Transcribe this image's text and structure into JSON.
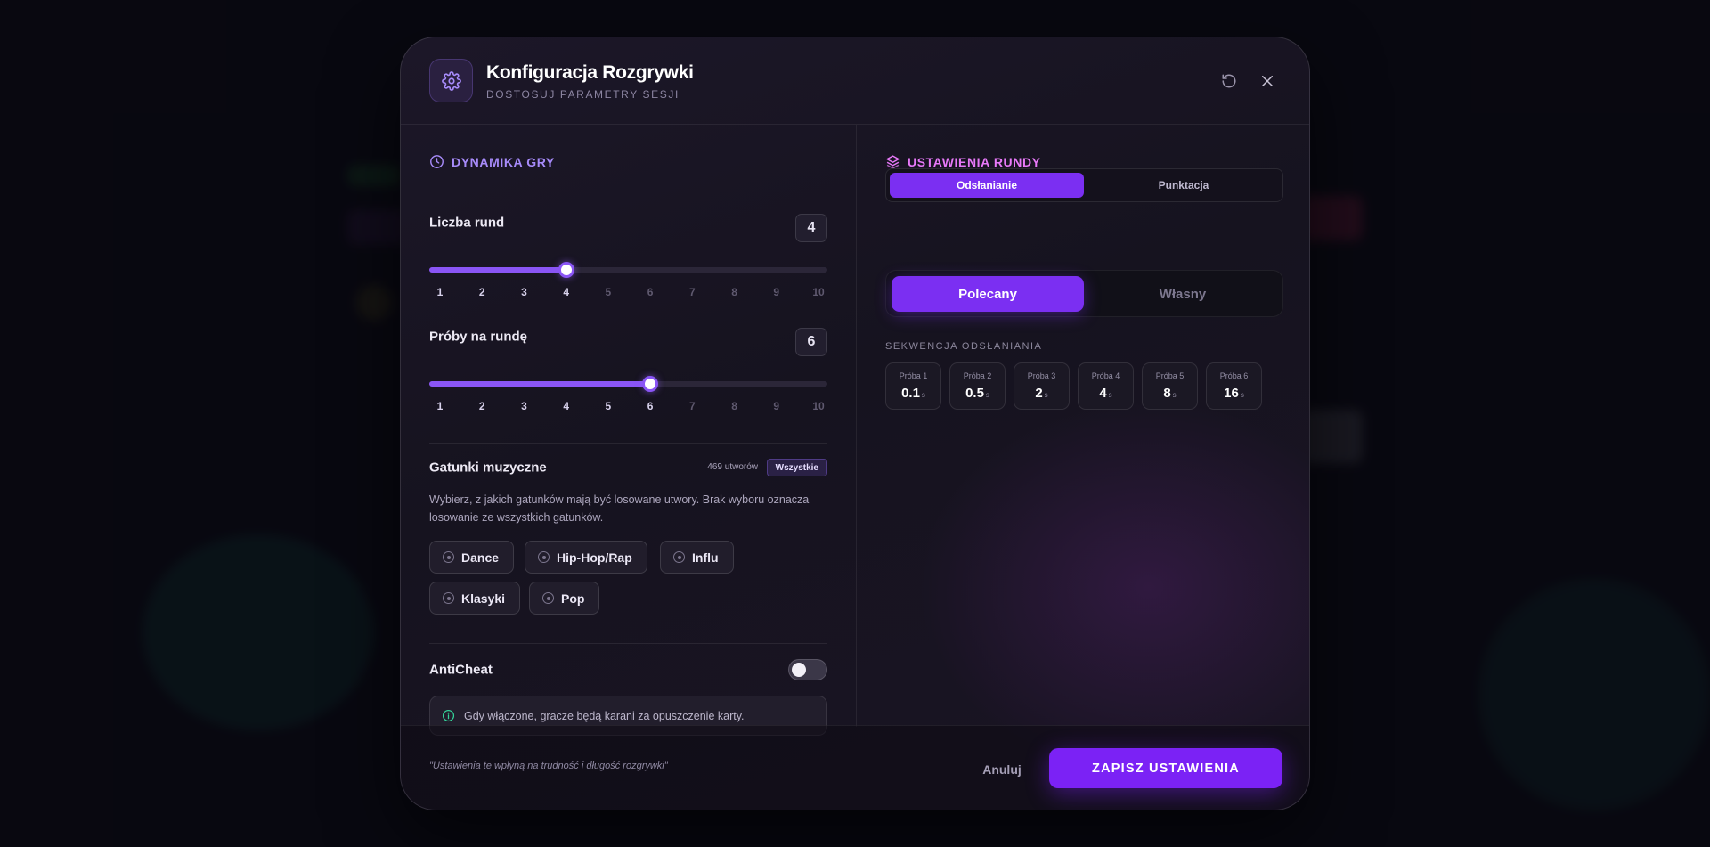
{
  "colors": {
    "accent": "#7b2ff2",
    "section_left": "#a78bfa",
    "section_right": "#e879f9",
    "info_icon": "#34d399"
  },
  "header": {
    "icon": "gear-icon",
    "title": "Konfiguracja Rozgrywki",
    "subtitle": "DOSTOSUJ PARAMETRY SESJI",
    "reset_icon": "reset-icon",
    "close_icon": "close-icon"
  },
  "left": {
    "section_title": "DYNAMIKA GRY",
    "section_icon": "clock-icon",
    "rounds": {
      "label": "Liczba rund",
      "value": "4",
      "selected": 4,
      "min": 1,
      "max": 10,
      "ticks": [
        "1",
        "2",
        "3",
        "4",
        "5",
        "6",
        "7",
        "8",
        "9",
        "10"
      ]
    },
    "attempts": {
      "label": "Próby na rundę",
      "value": "6",
      "selected": 6,
      "min": 1,
      "max": 10,
      "ticks": [
        "1",
        "2",
        "3",
        "4",
        "5",
        "6",
        "7",
        "8",
        "9",
        "10"
      ]
    },
    "genres": {
      "label": "Gatunki muzyczne",
      "count": "469 utworów",
      "badge": "Wszystkie",
      "description": "Wybierz, z jakich gatunków mają być losowane utwory. Brak wyboru oznacza losowanie ze wszystkich gatunków.",
      "items": [
        "Dance",
        "Hip-Hop/Rap",
        "Influ",
        "Klasyki",
        "Pop"
      ]
    },
    "anticheat": {
      "label": "AntiCheat",
      "enabled": false,
      "info": "Gdy włączone, gracze będą karani za opuszczenie karty.",
      "info_icon": "info-icon"
    }
  },
  "right": {
    "section_title": "USTAWIENIA RUNDY",
    "section_icon": "layers-icon",
    "tabs": [
      {
        "label": "Odsłanianie",
        "active": true
      },
      {
        "label": "Punktacja",
        "active": false
      }
    ],
    "mode": [
      {
        "label": "Polecany",
        "active": true
      },
      {
        "label": "Własny",
        "active": false
      }
    ],
    "sequence_label": "SEKWENCJA ODSŁANIANIA",
    "steps": [
      {
        "label": "Próba 1",
        "value": "0.1",
        "unit": "s"
      },
      {
        "label": "Próba 2",
        "value": "0.5",
        "unit": "s"
      },
      {
        "label": "Próba 3",
        "value": "2",
        "unit": "s"
      },
      {
        "label": "Próba 4",
        "value": "4",
        "unit": "s"
      },
      {
        "label": "Próba 5",
        "value": "8",
        "unit": "s"
      },
      {
        "label": "Próba 6",
        "value": "16",
        "unit": "s"
      }
    ]
  },
  "footer": {
    "note": "\"Ustawienia te wpłyną na trudność i długość rozgrywki\"",
    "cancel": "Anuluj",
    "save": "ZAPISZ USTAWIENIA"
  }
}
